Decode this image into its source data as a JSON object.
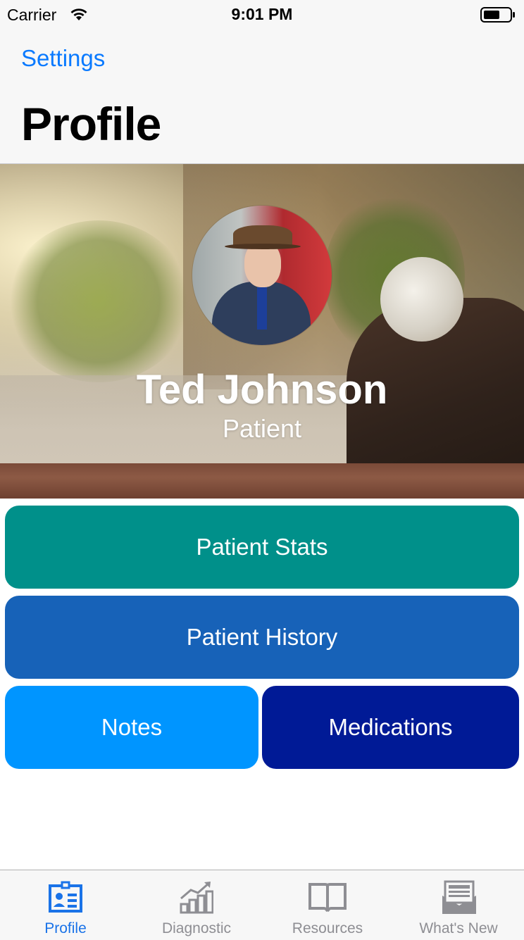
{
  "status_bar": {
    "carrier": "Carrier",
    "time": "9:01 PM"
  },
  "nav": {
    "back_label": "Settings",
    "title": "Profile"
  },
  "profile": {
    "name": "Ted Johnson",
    "role": "Patient"
  },
  "actions": {
    "patient_stats": "Patient Stats",
    "patient_history": "Patient History",
    "notes": "Notes",
    "medications": "Medications"
  },
  "colors": {
    "accent": "#1a73e8",
    "link": "#0a7aff",
    "patient_stats": "#00908a",
    "patient_history": "#1762b8",
    "notes": "#0095ff",
    "medications": "#001a96",
    "tab_inactive": "#8e8e93"
  },
  "tab_bar": {
    "tabs": [
      {
        "label": "Profile",
        "icon": "profile-card-icon",
        "active": true
      },
      {
        "label": "Diagnostic",
        "icon": "chart-trend-icon",
        "active": false
      },
      {
        "label": "Resources",
        "icon": "book-icon",
        "active": false
      },
      {
        "label": "What's New",
        "icon": "newsletter-icon",
        "active": false
      }
    ]
  }
}
